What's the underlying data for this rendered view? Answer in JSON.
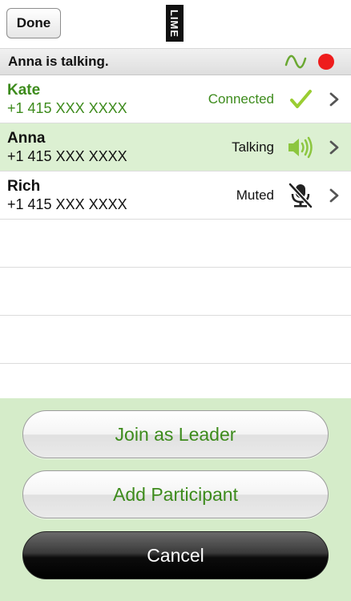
{
  "header": {
    "done_label": "Done",
    "logo_text": "LIME"
  },
  "status": {
    "text": "Anna is talking.",
    "wave_color": "#6aa832",
    "record_color": "#ee1c1c"
  },
  "participants": [
    {
      "name": "Kate",
      "phone": "+1 415 XXX XXXX",
      "state": "Connected",
      "icon": "checkmark-icon",
      "highlighted": false,
      "accent": "#3d8b1c"
    },
    {
      "name": "Anna",
      "phone": "+1 415 XXX XXXX",
      "state": "Talking",
      "icon": "speaker-icon",
      "highlighted": true,
      "accent": "#8cc63f"
    },
    {
      "name": "Rich",
      "phone": "+1 415 XXX XXXX",
      "state": "Muted",
      "icon": "muted-mic-icon",
      "highlighted": false,
      "accent": "#111111"
    }
  ],
  "actions": {
    "join_leader_label": "Join as Leader",
    "add_participant_label": "Add Participant",
    "cancel_label": "Cancel"
  },
  "colors": {
    "bottom_bg": "#d5ecc9",
    "highlight_row": "#dcf0d2",
    "green_text": "#3d8b1c"
  }
}
